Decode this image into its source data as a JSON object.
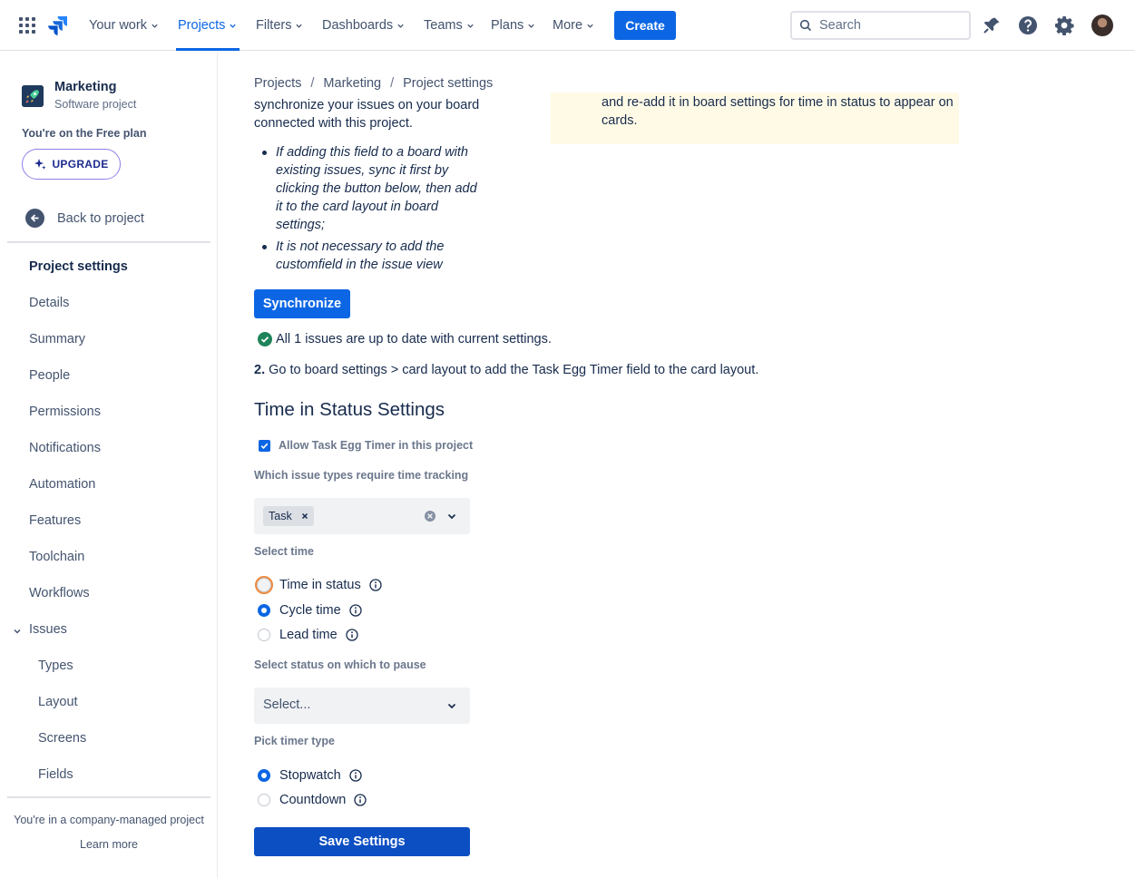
{
  "nav": {
    "items": [
      {
        "label": "Your work"
      },
      {
        "label": "Projects"
      },
      {
        "label": "Filters"
      },
      {
        "label": "Dashboards"
      },
      {
        "label": "Teams"
      },
      {
        "label": "Plans"
      },
      {
        "label": "More"
      }
    ],
    "create_label": "Create",
    "search_placeholder": "Search"
  },
  "sidebar": {
    "project_name": "Marketing",
    "project_type": "Software project",
    "plan_text": "You're on the Free plan",
    "upgrade_label": "UPGRADE",
    "back_label": "Back to project",
    "section_title": "Project settings",
    "items": [
      "Details",
      "Summary",
      "People",
      "Permissions",
      "Notifications",
      "Automation",
      "Features",
      "Toolchain",
      "Workflows",
      "Issues"
    ],
    "issue_subitems": [
      "Types",
      "Layout",
      "Screens",
      "Fields"
    ],
    "footer_text": "You're in a company-managed project",
    "footer_link": "Learn more"
  },
  "breadcrumb": [
    "Projects",
    "Marketing",
    "Project settings"
  ],
  "warning_text": "and re-add it in board settings for time in status to appear on cards.",
  "intro_text": "synchronize your issues on your board connected with this project.",
  "bullets": [
    "If adding this field to a board with existing issues, sync it first by clicking the button below, then add it to the card layout in board settings;",
    "It is not necessary to add the customfield in the issue view"
  ],
  "sync_label": "Synchronize",
  "sync_status": "All 1 issues are up to date with current settings.",
  "step2_number": "2.",
  "step2_text": "Go to board settings > card layout to add the Task Egg Timer field to the card layout.",
  "section_title": "Time in Status Settings",
  "allow_label": "Allow Task Egg Timer in this project",
  "issue_types_label": "Which issue types require time tracking",
  "issue_types_selected": [
    "Task"
  ],
  "select_time_label": "Select time",
  "time_options": [
    {
      "label": "Time in status",
      "selected": false
    },
    {
      "label": "Cycle time",
      "selected": true
    },
    {
      "label": "Lead time",
      "selected": false
    }
  ],
  "pause_label": "Select status on which to pause",
  "pause_placeholder": "Select...",
  "timer_type_label": "Pick timer type",
  "timer_options": [
    {
      "label": "Stopwatch",
      "selected": true
    },
    {
      "label": "Countdown",
      "selected": false
    }
  ],
  "save_label": "Save Settings",
  "colors": {
    "primary": "#0c66e4",
    "success": "#1f845a",
    "warning_bg": "#fffae6",
    "focus": "#ef8a3e"
  }
}
